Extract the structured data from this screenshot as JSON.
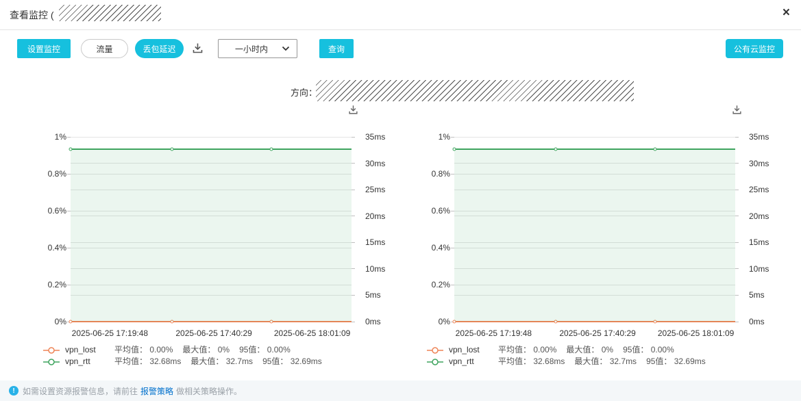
{
  "dialog": {
    "title_prefix": "查看监控 (",
    "close_glyph": "×"
  },
  "toolbar": {
    "set_monitor_button": "设置监控",
    "traffic_button": "流量",
    "loss_delay_button": "丢包延迟",
    "download_icon": "download-icon",
    "time_range_value": "一小时内",
    "query_button": "查询",
    "public_cloud_button": "公有云监控"
  },
  "direction_label": "方向：",
  "footer": {
    "info_glyph": "!",
    "text_before": "如需设置资源报警信息，请前往",
    "link_text": "报警策略",
    "text_after": "做相关策略操作。"
  },
  "colors": {
    "accent_cyan": "#16c0de",
    "vpn_lost_orange": "#ee8456",
    "vpn_rtt_green": "#3ea45e",
    "area_fill_green": "rgba(62,164,94,0.10)",
    "link_blue": "#0070cc",
    "gridline": "#e4e4e4"
  },
  "chart_data": [
    {
      "type": "line",
      "x": [
        "2025-06-25 17:19:48",
        "2025-06-25 17:40:29",
        "2025-06-25 18:01:09"
      ],
      "x_label_fractions": [
        0.14,
        0.51,
        0.86
      ],
      "point_fractions": [
        0.0,
        0.36,
        0.715
      ],
      "left_axis": {
        "unit": "%",
        "ticks": [
          "1%",
          "0.8%",
          "0.6%",
          "0.4%",
          "0.2%",
          "0%"
        ],
        "min": 0,
        "max": 1
      },
      "right_axis": {
        "unit": "ms",
        "ticks": [
          "35ms",
          "30ms",
          "25ms",
          "20ms",
          "15ms",
          "10ms",
          "5ms",
          "0ms"
        ],
        "min": 0,
        "max": 35
      },
      "series": [
        {
          "name": "vpn_lost",
          "axis": "left",
          "color": "#ee8456",
          "values": [
            0,
            0,
            0
          ],
          "stats": {
            "avg": "0.00%",
            "max": "0%",
            "p95": "0.00%"
          }
        },
        {
          "name": "vpn_rtt",
          "axis": "right",
          "color": "#3ea45e",
          "values": [
            32.68,
            32.68,
            32.68
          ],
          "area_fill": "rgba(62,164,94,0.10)",
          "stats": {
            "avg": "32.68ms",
            "max": "32.7ms",
            "p95": "32.69ms"
          }
        }
      ],
      "stat_labels": {
        "avg": "平均值：",
        "max": "最大值：",
        "p95": "95值："
      },
      "grid": true,
      "legend_position": "bottom-left"
    },
    {
      "type": "line",
      "x": [
        "2025-06-25 17:19:48",
        "2025-06-25 17:40:29",
        "2025-06-25 18:01:09"
      ],
      "x_label_fractions": [
        0.14,
        0.51,
        0.86
      ],
      "point_fractions": [
        0.0,
        0.36,
        0.715
      ],
      "left_axis": {
        "unit": "%",
        "ticks": [
          "1%",
          "0.8%",
          "0.6%",
          "0.4%",
          "0.2%",
          "0%"
        ],
        "min": 0,
        "max": 1
      },
      "right_axis": {
        "unit": "ms",
        "ticks": [
          "35ms",
          "30ms",
          "25ms",
          "20ms",
          "15ms",
          "10ms",
          "5ms",
          "0ms"
        ],
        "min": 0,
        "max": 35
      },
      "series": [
        {
          "name": "vpn_lost",
          "axis": "left",
          "color": "#ee8456",
          "values": [
            0,
            0,
            0
          ],
          "stats": {
            "avg": "0.00%",
            "max": "0%",
            "p95": "0.00%"
          }
        },
        {
          "name": "vpn_rtt",
          "axis": "right",
          "color": "#3ea45e",
          "values": [
            32.68,
            32.68,
            32.68
          ],
          "area_fill": "rgba(62,164,94,0.10)",
          "stats": {
            "avg": "32.68ms",
            "max": "32.7ms",
            "p95": "32.69ms"
          }
        }
      ],
      "stat_labels": {
        "avg": "平均值：",
        "max": "最大值：",
        "p95": "95值："
      },
      "grid": true,
      "legend_position": "bottom-left"
    }
  ]
}
